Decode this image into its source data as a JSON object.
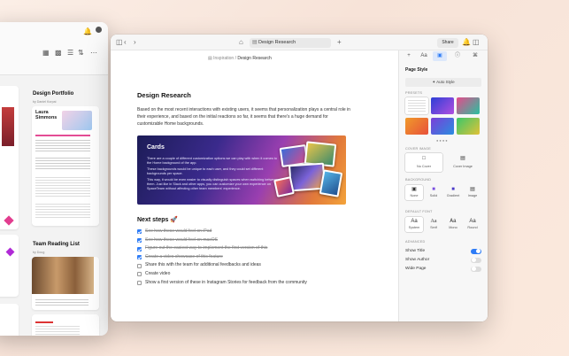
{
  "back_window": {
    "col2_title_1": "Design Portfolio",
    "col2_sub_1": "by Daniel Korpai",
    "card_name": "Laura Simmons",
    "col2_title_2": "Team Reading List",
    "col2_sub_2": "by Doug"
  },
  "toolbar": {
    "address": "Design Research",
    "share_label": "Share"
  },
  "breadcrumb": {
    "parent": "Inspiration",
    "current": "Design Research"
  },
  "document": {
    "title": "Design Research",
    "paragraph": "Based on the most recent interactions with existing users, it seems that personalization plays a central role in their experience, and based on the initial reactions so far, it seems that there's a huge demand for customizable Home backgrounds.",
    "banner": {
      "title": "Cards",
      "lines": [
        "There are a couple of different customization options we can play with when it comes to the Home background of the app.",
        "These backgrounds would be unique to each user, and they could set different backgrounds per space.",
        "This way, it would be even easier to visually distinguish spaces when switching between them. Just like in Slack and other apps, you can customize your own experience on SpaceTeam without affecting other team members' experience."
      ]
    },
    "next_steps_title": "Next steps 🚀",
    "steps": [
      {
        "label": "See how these would feel on iPad",
        "done": true
      },
      {
        "label": "See how these would feel on macOS",
        "done": true
      },
      {
        "label": "Figure out the easiest way to implement the first version of this",
        "done": true
      },
      {
        "label": "Create a video showcase of this feature",
        "done": true
      },
      {
        "label": "Share this with the team for additional feedbacks and ideas",
        "done": false
      },
      {
        "label": "Create video",
        "done": false
      },
      {
        "label": "Show a first version of these in Instagram Stories for feedback from the community",
        "done": false
      }
    ]
  },
  "panel": {
    "heading": "Page Style",
    "auto_style": "Auto Style",
    "presets_label": "PRESETS",
    "cover_image_label": "COVER IMAGE",
    "cover_options": [
      {
        "label": "No Cover"
      },
      {
        "label": "Cover Image"
      }
    ],
    "background_label": "BACKGROUND",
    "background_options": [
      {
        "label": "None"
      },
      {
        "label": "Solid"
      },
      {
        "label": "Gradient"
      },
      {
        "label": "Image"
      }
    ],
    "default_font_label": "DEFAULT FONT",
    "font_options": [
      {
        "sample": "Aa",
        "label": "System"
      },
      {
        "sample": "Aa",
        "label": "Serif"
      },
      {
        "sample": "Aa",
        "label": "Mono"
      },
      {
        "sample": "Aa",
        "label": "Round"
      }
    ],
    "advanced_label": "ADVANCED",
    "toggles": [
      {
        "label": "Show Title",
        "on": true
      },
      {
        "label": "Show Author",
        "on": false
      },
      {
        "label": "Wide Page",
        "on": false
      }
    ]
  }
}
